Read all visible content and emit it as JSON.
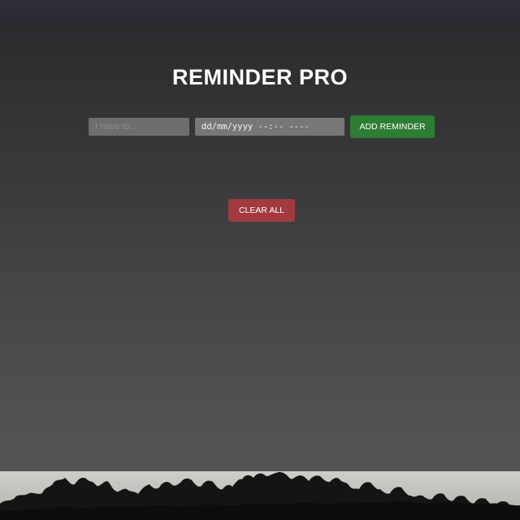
{
  "app": {
    "title": "REMINDER PRO"
  },
  "form": {
    "task_placeholder": "I have to...",
    "task_value": "",
    "date_display": "dd/mm/yyyy --:-- ----",
    "add_label": "ADD REMINDER"
  },
  "actions": {
    "clear_label": "CLEAR ALL"
  },
  "colors": {
    "add_button": "#2e7d32",
    "clear_button": "#a33a3f",
    "title_text": "#ffffff"
  },
  "background": {
    "image": "tree-line-silhouette"
  }
}
